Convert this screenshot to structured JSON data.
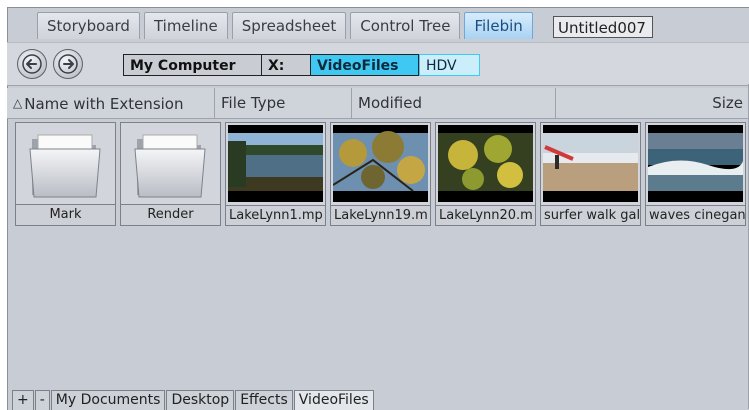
{
  "tabs": [
    {
      "label": "Storyboard"
    },
    {
      "label": "Timeline"
    },
    {
      "label": "Spreadsheet"
    },
    {
      "label": "Control Tree"
    },
    {
      "label": "Filebin"
    }
  ],
  "document_name": "Untitled007",
  "nav": {
    "back_icon": "back-arrow-icon",
    "forward_icon": "forward-arrow-icon",
    "path": {
      "root": "My Computer",
      "drive": "X:",
      "folder": "VideoFiles",
      "subfolder": "HDV"
    }
  },
  "columns": {
    "name": "Name with Extension",
    "type": "File Type",
    "modified": "Modified",
    "size": "Size",
    "sort_icon": "sort-ascending-icon"
  },
  "items": [
    {
      "label": "Mark",
      "kind": "folder"
    },
    {
      "label": "Render",
      "kind": "folder"
    },
    {
      "label": "LakeLynn1.mp",
      "kind": "video"
    },
    {
      "label": "LakeLynn19.m",
      "kind": "video"
    },
    {
      "label": "LakeLynn20.m",
      "kind": "video"
    },
    {
      "label": "surfer walk gal",
      "kind": "video"
    },
    {
      "label": "waves cinegan",
      "kind": "video"
    }
  ],
  "bottom_tabs": {
    "plus": "+",
    "minus": "-",
    "items": [
      {
        "label": "My Documents"
      },
      {
        "label": "Desktop"
      },
      {
        "label": "Effects"
      },
      {
        "label": "VideoFiles"
      }
    ]
  },
  "colors": {
    "accent": "#3fc8f2",
    "active_tab": "#a8d3f3",
    "panel": "#c8ccd4"
  }
}
